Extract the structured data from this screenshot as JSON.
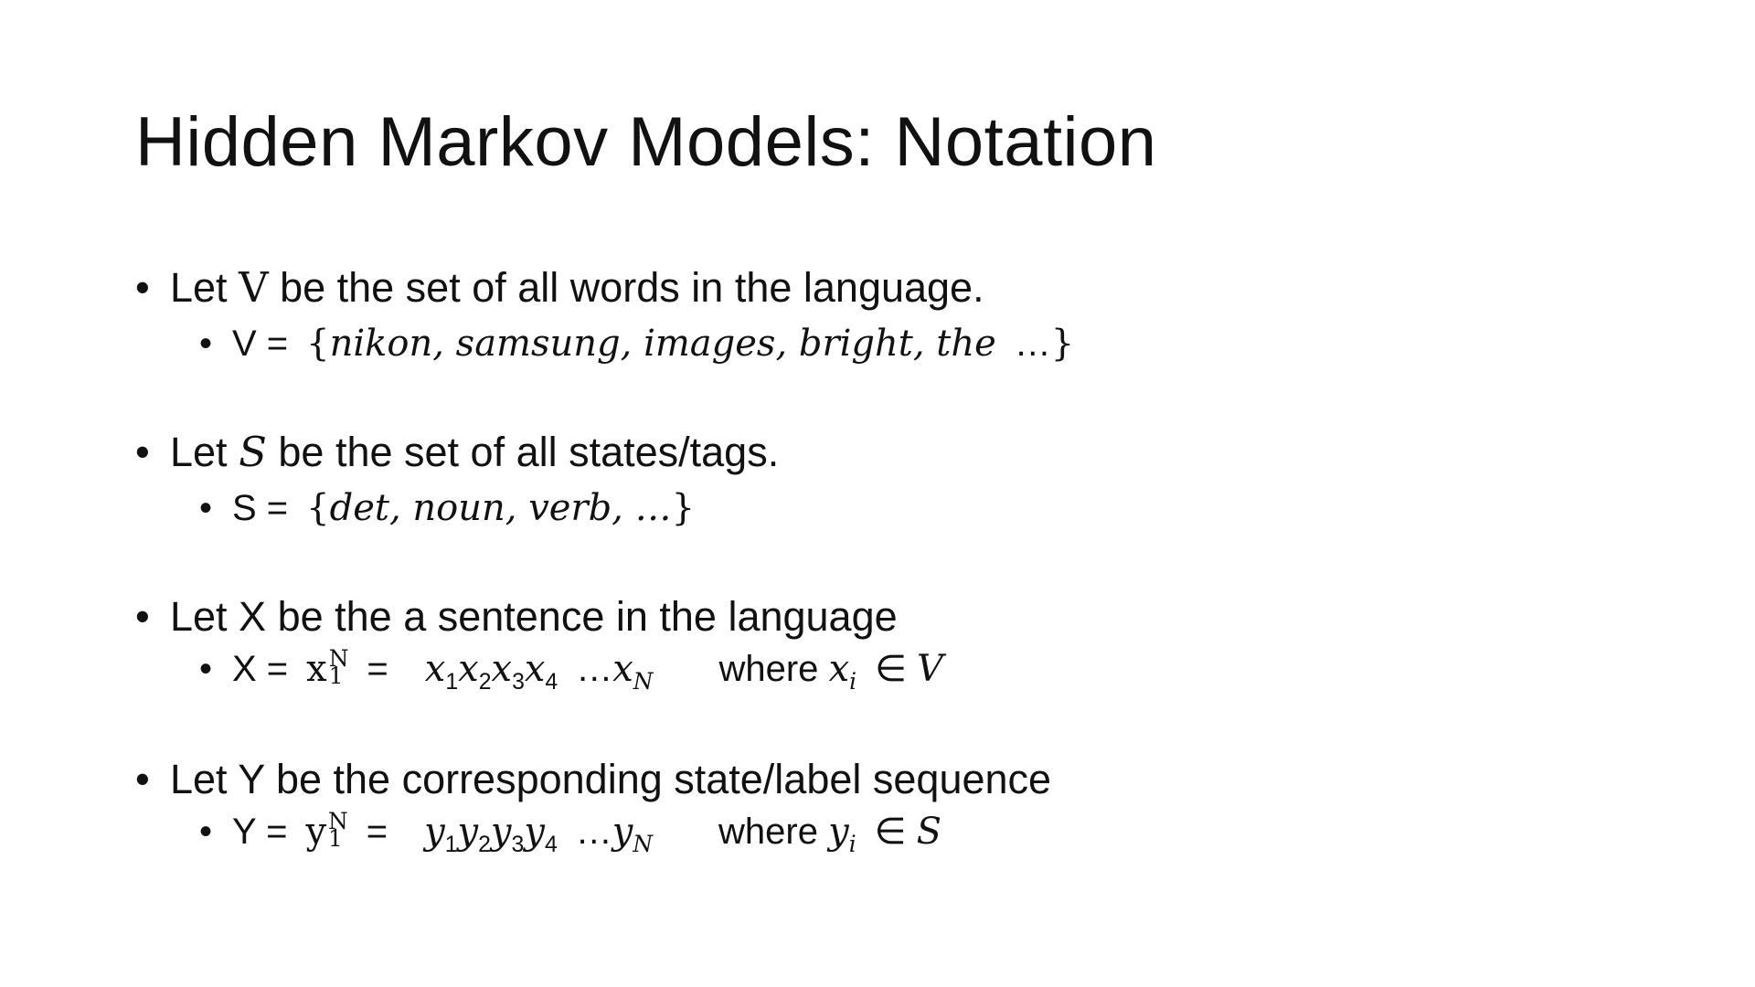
{
  "title": "Hidden Markov Models: Notation",
  "bullets": [
    {
      "text_before": "Let ",
      "symbol": "V",
      "text_after": " be the set of all words in the language.",
      "sub": {
        "lhs": "V =",
        "set_open": "{",
        "set_content": "nikon, samsung, images, bright, the",
        "ellipsis": "…",
        "set_close": "}"
      }
    },
    {
      "text_before": "Let ",
      "symbol": "S",
      "text_after": " be the set of all states/tags.",
      "sub": {
        "lhs": "S =",
        "set_open": "{",
        "set_content": "det, noun, verb, …",
        "set_close": "}"
      }
    },
    {
      "text": "Let X be the a sentence in the language",
      "sub": {
        "lhs": "X =",
        "var": "x",
        "sup": "N",
        "sub1": "1",
        "eq": "=",
        "seq": [
          "x",
          "x",
          "x",
          "x"
        ],
        "seq_subs": [
          "1",
          "2",
          "3",
          "4"
        ],
        "ellipsis": "…",
        "last_var": "x",
        "last_sub": "N",
        "where": "where",
        "where_var": "x",
        "where_sub": "i",
        "in": "∈",
        "set": "V"
      }
    },
    {
      "text": "Let Y be the corresponding state/label sequence",
      "sub": {
        "lhs": "Y =",
        "var": "y",
        "sup": "N",
        "sub1": "1",
        "eq": "=",
        "seq": [
          "y",
          "y",
          "y",
          "y"
        ],
        "seq_subs": [
          "1",
          "2",
          "3",
          "4"
        ],
        "ellipsis": "…",
        "last_var": "y",
        "last_sub": "N",
        "where": "where",
        "where_var": "y",
        "where_sub": "i",
        "in": "∈",
        "set": "S"
      }
    }
  ],
  "bullet_glyph": "•"
}
